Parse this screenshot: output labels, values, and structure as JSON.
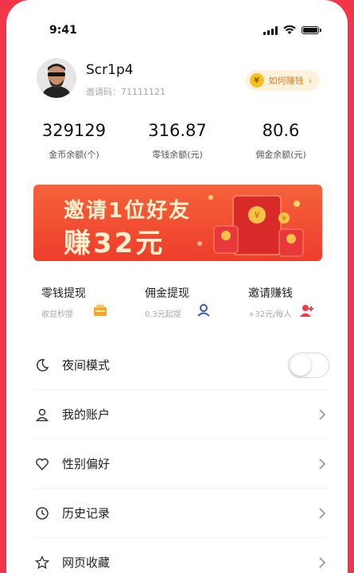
{
  "status_bar": {
    "time": "9:41"
  },
  "profile": {
    "username": "Scr1p4",
    "invite_code": "邀请码：71111121",
    "earn_button": {
      "coin_symbol": "¥",
      "label": "如何赚钱",
      "arrow": "›"
    }
  },
  "stats": [
    {
      "value": "329129",
      "label": "金币余额(个)"
    },
    {
      "value": "316.87",
      "label": "零钱余额(元)"
    },
    {
      "value": "80.6",
      "label": "佣金余额(元)"
    }
  ],
  "banner": {
    "line1": "邀请1位好友",
    "line2": "赚32元"
  },
  "quick_actions": [
    {
      "title": "零钱提现",
      "subtitle": "收益秒提",
      "icon": "wallet-icon"
    },
    {
      "title": "佣金提现",
      "subtitle": "0.3元起提",
      "icon": "user-badge-icon"
    },
    {
      "title": "邀请赚钱",
      "subtitle": "+32元/每人",
      "icon": "add-user-icon"
    }
  ],
  "menu": [
    {
      "label": "夜间模式",
      "icon": "moon-icon",
      "control": "toggle",
      "toggle_on": false
    },
    {
      "label": "我的账户",
      "icon": "person-icon",
      "control": "chevron"
    },
    {
      "label": "性别偏好",
      "icon": "heart-icon",
      "control": "chevron"
    },
    {
      "label": "历史记录",
      "icon": "clock-icon",
      "control": "chevron"
    },
    {
      "label": "网页收藏",
      "icon": "star-icon",
      "control": "chevron"
    }
  ],
  "colors": {
    "background": "#f1364a",
    "accent_orange": "#e07a1a",
    "banner_red": "#ee3d2c",
    "banner_text": "#fff1d0"
  }
}
